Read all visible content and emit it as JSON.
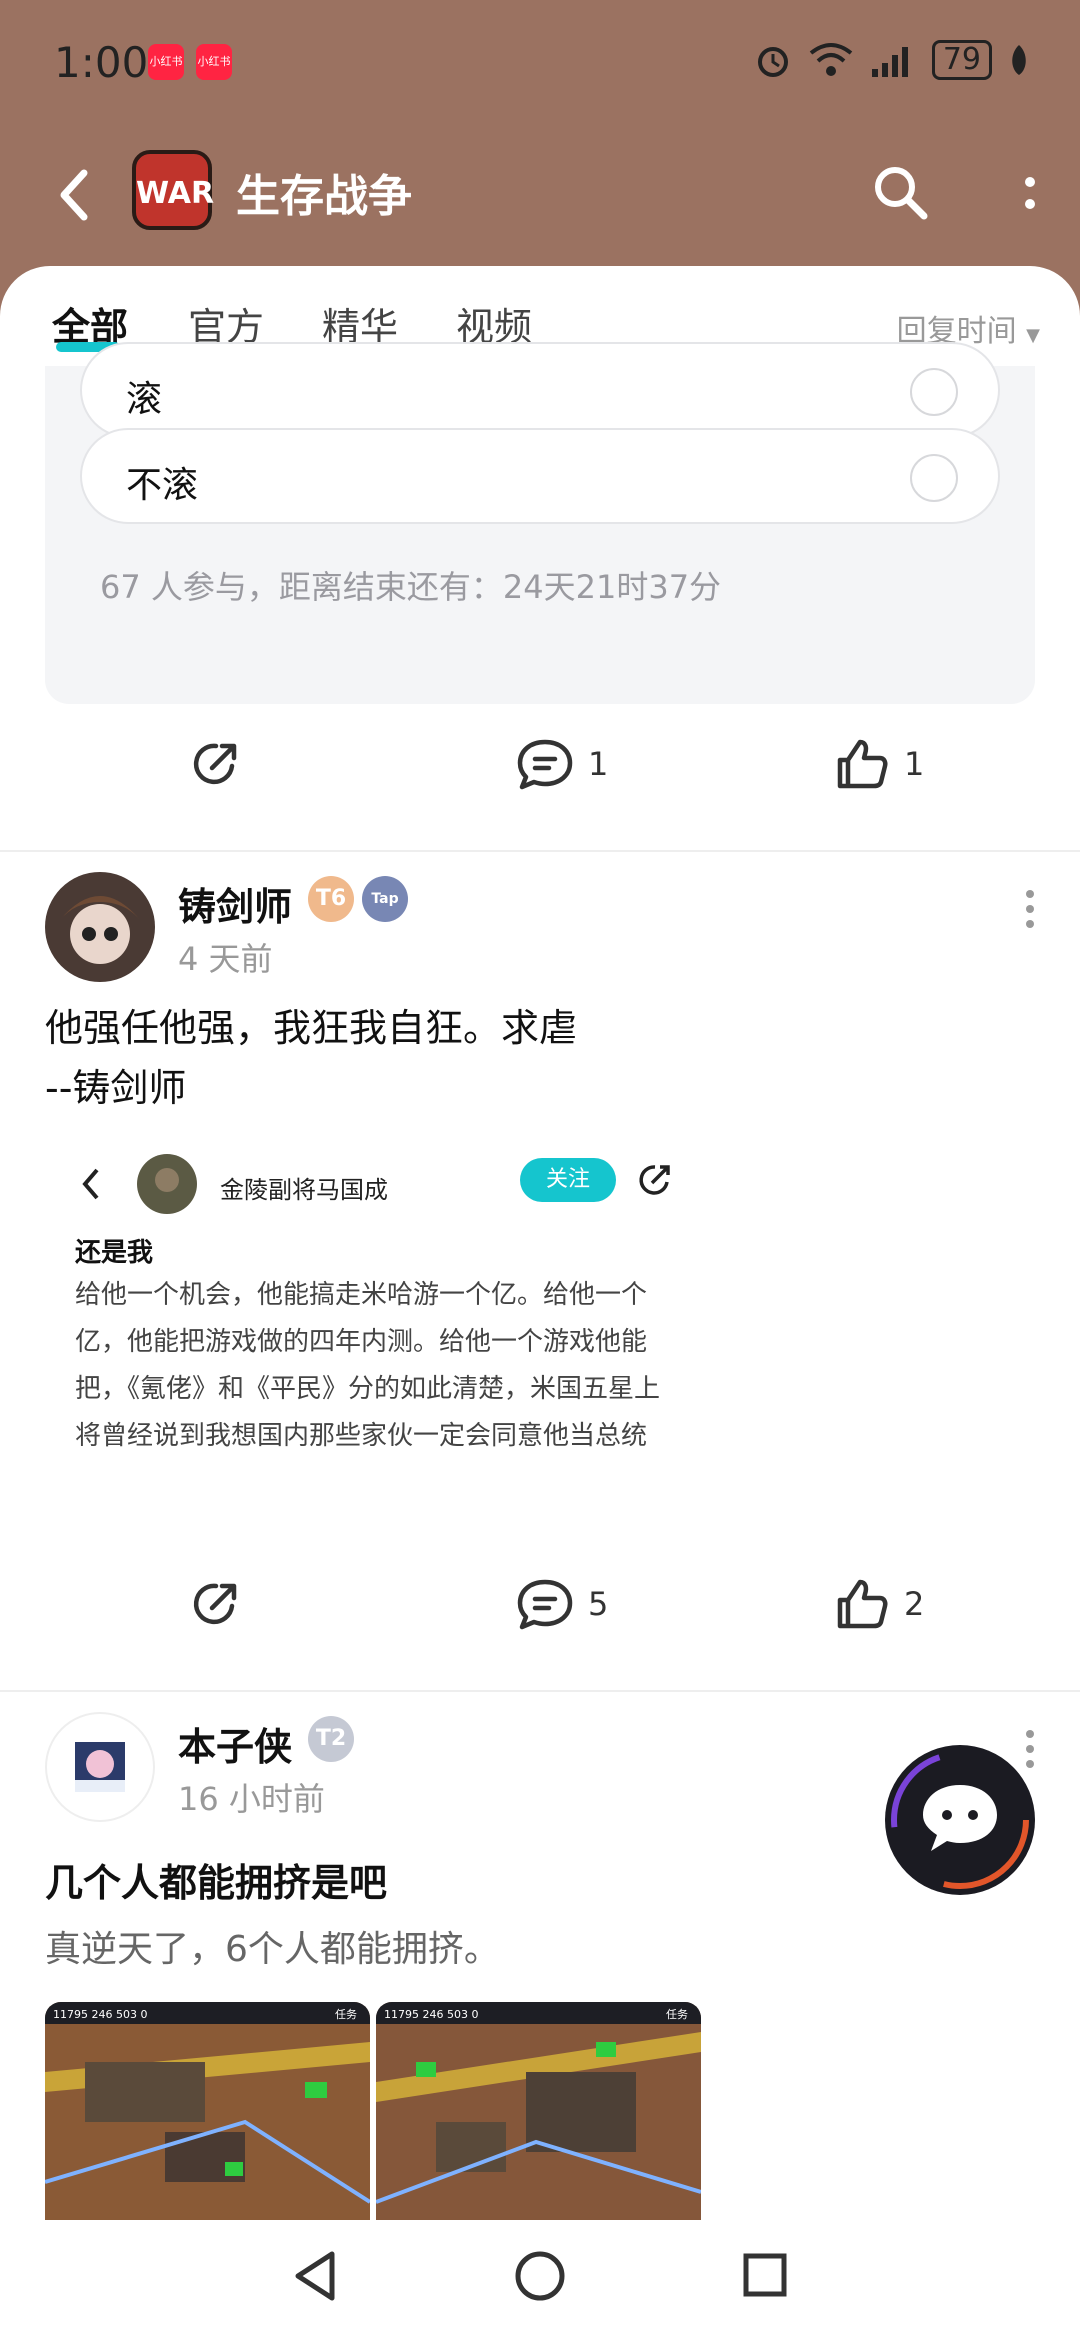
{
  "status_bar": {
    "time": "1:00",
    "notifications": [
      "小红书",
      "小红书"
    ],
    "battery": "79"
  },
  "header": {
    "logo_text": "WAR",
    "title": "生存战争"
  },
  "tabs": {
    "items": [
      "全部",
      "官方",
      "精华",
      "视频"
    ],
    "active_index": 0,
    "sort_label": "回复时间"
  },
  "poll": {
    "options": [
      "滚",
      "不滚"
    ],
    "meta": "67 人参与，距离结束还有：24天21时37分",
    "comments": "1",
    "likes": "1"
  },
  "post1": {
    "author": "铸剑师",
    "level": "T6",
    "tap_badge": "Tap",
    "time": "4 天前",
    "text_line1": "他强任他强，我狂我自狂。求虐",
    "text_line2": " --铸剑师",
    "embed": {
      "author": "金陵副将马国成",
      "follow": "关注",
      "title": "还是我",
      "body": "给他一个机会，他能搞走米哈游一个亿。给他一个亿，他能把游戏做的四年内测。给他一个游戏他能把，《氪佬》和《平民》分的如此清楚，米国五星上将曾经说到我想国内那些家伙一定会同意他当总统"
    },
    "comments": "5",
    "likes": "2"
  },
  "post2": {
    "author": "本子侠",
    "level": "T2",
    "time": "16 小时前",
    "title": "几个人都能拥挤是吧",
    "subtitle": "真逆天了，6个人都能拥挤。",
    "shot_hud": [
      "11795",
      "246",
      "503",
      "0",
      "任务"
    ]
  },
  "colors": {
    "header_bg": "#9b7261",
    "accent": "#15c5ce"
  }
}
